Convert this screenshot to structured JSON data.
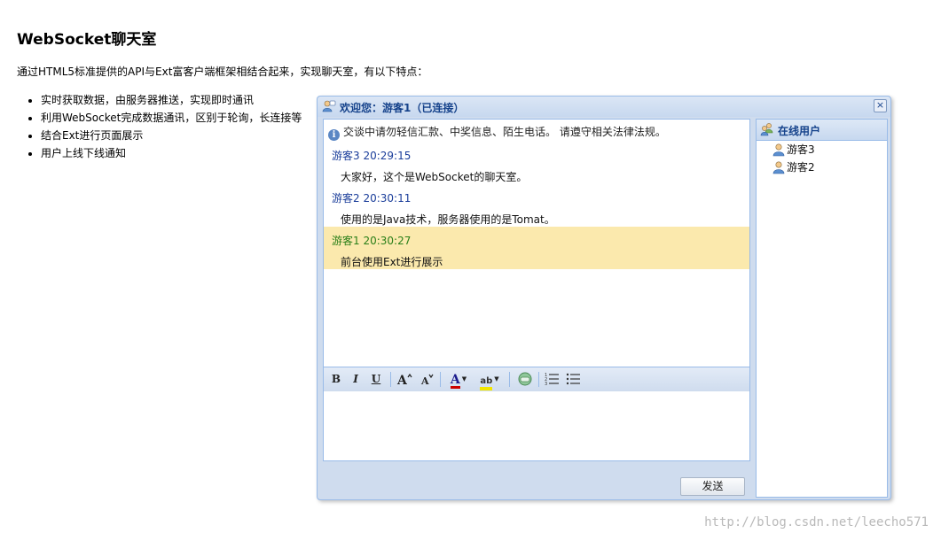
{
  "page": {
    "title": "WebSocket聊天室",
    "intro": "通过HTML5标准提供的API与Ext富客户端框架相结合起来，实现聊天室，有以下特点：",
    "features": [
      "实时获取数据，由服务器推送，实现即时通讯",
      "利用WebSocket完成数据通讯，区别于轮询，长连接等",
      "结合Ext进行页面展示",
      "用户上线下线通知"
    ]
  },
  "window": {
    "title": "欢迎您：游客1（已连接）",
    "close_label": "×",
    "notice": "交谈中请勿轻信汇款、中奖信息、陌生电话。 请遵守相关法律法规。",
    "messages": [
      {
        "sender": "游客3 20:29:15",
        "text": "大家好，这个是WebSocket的聊天室。",
        "self": false
      },
      {
        "sender": "游客2 20:30:11",
        "text": "使用的是Java技术，服务器使用的是Tomat。",
        "self": false
      },
      {
        "sender": "游客1 20:30:27",
        "text": "前台使用Ext进行展示",
        "self": true
      }
    ],
    "toolbar": {
      "bold": "B",
      "italic": "I",
      "underline": "U",
      "font_color_letter": "A",
      "highlight_letter": "ab",
      "font_color": "#cc0000",
      "highlight_color": "#f2e600"
    },
    "editor_value": "",
    "send_label": "发送"
  },
  "users_panel": {
    "title": "在线用户",
    "users": [
      "游客3",
      "游客2"
    ]
  },
  "watermark": "http://blog.csdn.net/leecho571",
  "colors": {
    "accent": "#15428b",
    "border": "#99bbe8",
    "self_message_bg": "#fbe9ad",
    "other_sender": "#1a3d9a",
    "self_sender": "#2a7f18"
  }
}
